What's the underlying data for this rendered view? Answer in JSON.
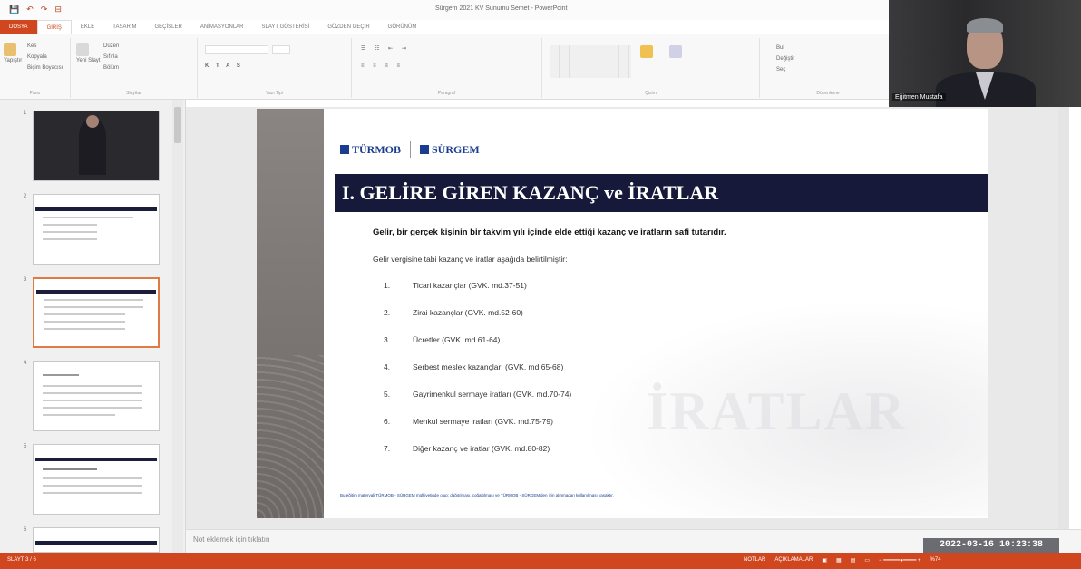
{
  "window": {
    "title": "Sürgem 2021 KV Sunumu Semet - PowerPoint",
    "quick_access": [
      "💾",
      "↶",
      "↷",
      "⊟"
    ]
  },
  "ribbon": {
    "tabs": [
      "DOSYA",
      "GİRİŞ",
      "EKLE",
      "TASARIM",
      "GEÇİŞLER",
      "ANİMASYONLAR",
      "SLAYT GÖSTERİSİ",
      "GÖZDEN GEÇİR",
      "GÖRÜNÜM"
    ],
    "active_tab": "GİRİŞ",
    "groups": [
      "Pano",
      "Slaytlar",
      "Yazı Tipi",
      "Paragraf",
      "Çizim",
      "Düzenleme"
    ],
    "buttons": {
      "paste": "Yapıştır",
      "cut": "Kes",
      "copy": "Kopyala",
      "format_painter": "Biçim Boyacısı",
      "new_slide": "Yeni Slayt",
      "layout": "Düzen",
      "reset": "Sıfırla",
      "section": "Bölüm",
      "find": "Bul",
      "replace": "Değiştir",
      "select": "Seç"
    }
  },
  "webcam": {
    "name": "Eğitmen Mustafa"
  },
  "thumbnails": [
    {
      "num": "1"
    },
    {
      "num": "2"
    },
    {
      "num": "3"
    },
    {
      "num": "4"
    },
    {
      "num": "5"
    },
    {
      "num": "6"
    }
  ],
  "slide": {
    "logo1": "TÜRMOB",
    "logo2": "SÜRGEM",
    "title": "I. GELİRE GİREN KAZANÇ ve İRATLAR",
    "subtitle": "Gelir, bir gerçek kişinin bir takvim yılı içinde elde ettiği kazanç ve iratların safi tutarıdır.",
    "intro": "Gelir vergisine tabi kazanç ve iratlar aşağıda belirtilmiştir:",
    "items": [
      {
        "n": "1.",
        "text": "Ticari kazançlar (GVK. md.37-51)"
      },
      {
        "n": "2.",
        "text": "Zirai kazançlar (GVK. md.52-60)"
      },
      {
        "n": "3.",
        "text": "Ücretler (GVK. md.61-64)"
      },
      {
        "n": "4.",
        "text": "Serbest meslek kazançları (GVK. md.65-68)"
      },
      {
        "n": "5.",
        "text": "Gayrimenkul sermaye iratları (GVK. md.70-74)"
      },
      {
        "n": "6.",
        "text": "Menkul sermaye iratları (GVK. md.75-79)"
      },
      {
        "n": "7.",
        "text": "Diğer kazanç ve iratlar (GVK. md.80-82)"
      }
    ],
    "watermark": "İRATLAR",
    "footer": "Bu eğitim materyali TÜRMOB - SÜRGEM mülkiyetinde olup; dağıtılması, çoğaltılması ve TÜRMOB - SÜRGEM'den izin alınmadan kullanılması yasaktır."
  },
  "notes": {
    "placeholder": "Not eklemek için tıklatın"
  },
  "status": {
    "slide_info": "SLAYT 3 / 6",
    "notes_btn": "NOTLAR",
    "comments_btn": "AÇIKLAMALAR",
    "zoom": "%74"
  },
  "timestamp": "2022-03-16 10:23:38",
  "colors": {
    "accent": "#d0461f",
    "title_bar": "#16193a",
    "logo_blue": "#1a3d8f"
  }
}
